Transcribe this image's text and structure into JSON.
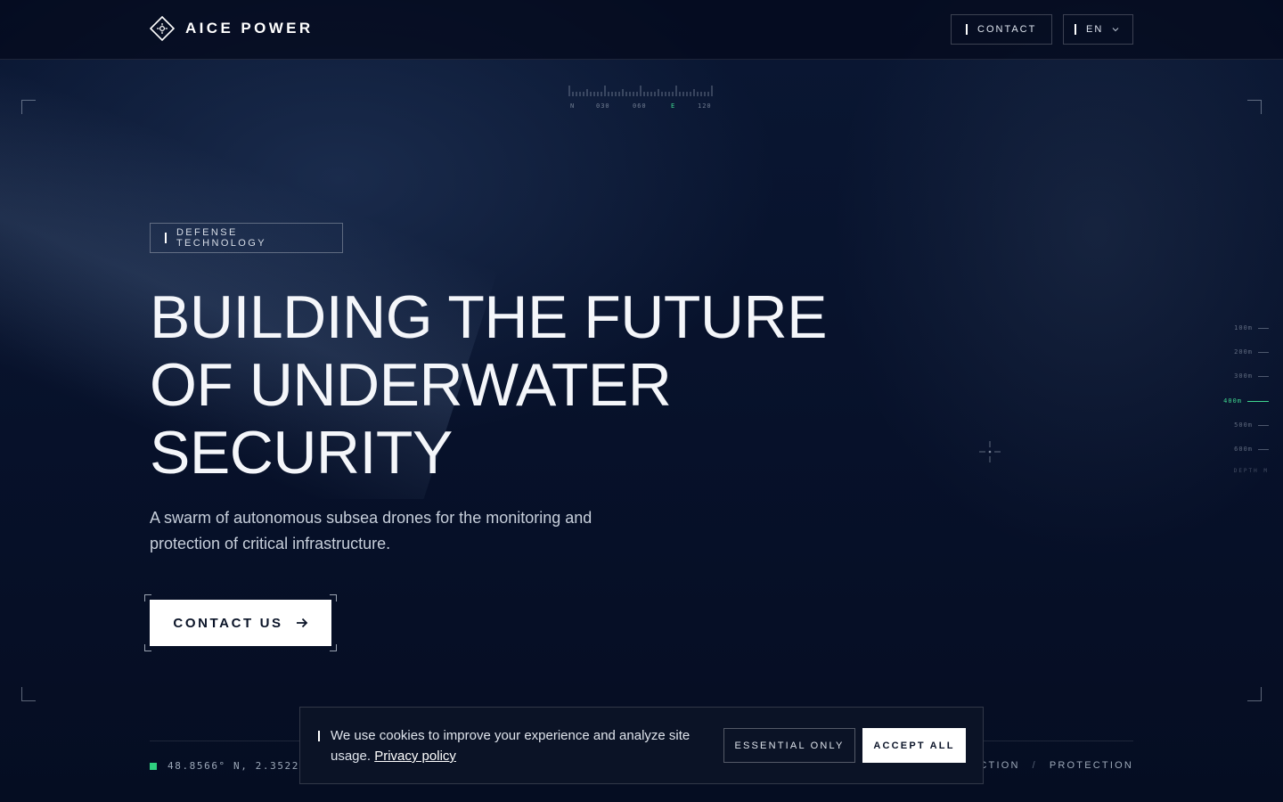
{
  "header": {
    "brand": "AICE POWER",
    "contact_label": "CONTACT",
    "language_label": "EN"
  },
  "hud": {
    "compass_labels": [
      "N",
      "030",
      "060",
      "E",
      "120"
    ],
    "depth_levels": [
      "100m",
      "200m",
      "300m",
      "400m",
      "500m",
      "600m"
    ],
    "depth_active": "400m",
    "depth_title": "DEPTH M"
  },
  "hero": {
    "tag": "DEFENSE TECHNOLOGY",
    "headline_lines": [
      "BUILDING THE FUTURE",
      "OF UNDERWATER",
      "SECURITY"
    ],
    "subtitle": "A swarm of autonomous subsea drones for the monitoring and protection of critical infrastructure.",
    "cta_label": "CONTACT US"
  },
  "footer": {
    "coordinates": "48.8566° N, 2.3522°",
    "tags": [
      "ECTION",
      "PROTECTION"
    ]
  },
  "cookie": {
    "text": "We use cookies to improve your experience and analyze site usage.",
    "link_label": "Privacy policy",
    "essential_label": "ESSENTIAL ONLY",
    "accept_label": "ACCEPT ALL"
  },
  "colors": {
    "background": "#071029",
    "accent_green": "#3fd68f",
    "text_primary": "#f4f6fa",
    "text_muted": "#9ca8b8"
  }
}
